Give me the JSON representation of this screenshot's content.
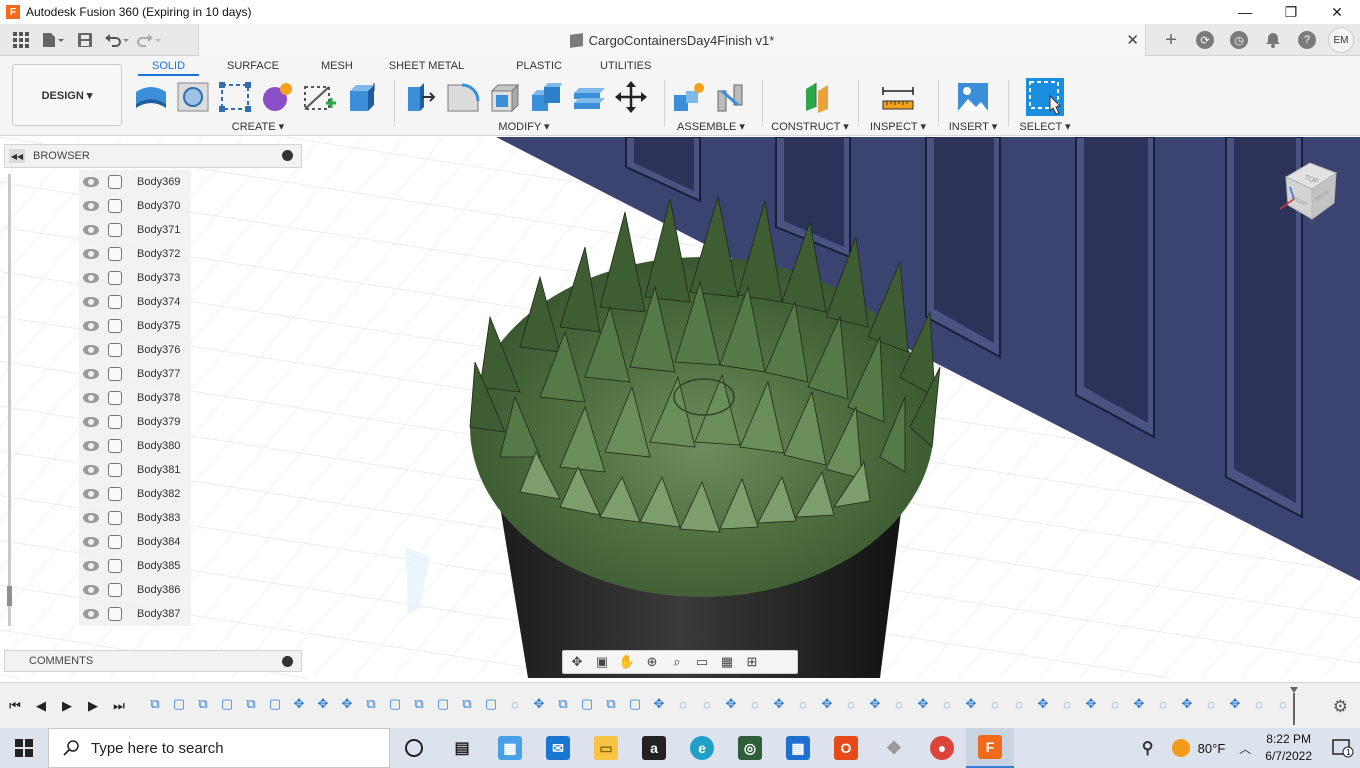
{
  "window": {
    "title": "Autodesk Fusion 360 (Expiring in 10 days)",
    "minimize": "—",
    "maximize": "❐",
    "close": "✕"
  },
  "document": {
    "name": "CargoContainersDay4Finish v1*",
    "close": "✕"
  },
  "tabrow": {
    "plus": "+",
    "avatar": "EM"
  },
  "toolbar": {
    "design_label": "DESIGN ▾",
    "workspace_tabs": [
      "SOLID",
      "SURFACE",
      "MESH",
      "SHEET METAL",
      "PLASTIC",
      "UTILITIES"
    ],
    "groups": {
      "create": "CREATE ▾",
      "modify": "MODIFY ▾",
      "assemble": "ASSEMBLE ▾",
      "construct": "CONSTRUCT ▾",
      "inspect": "INSPECT ▾",
      "insert": "INSERT ▾",
      "select": "SELECT ▾"
    }
  },
  "browser": {
    "title": "BROWSER",
    "bodies": [
      "Body369",
      "Body370",
      "Body371",
      "Body372",
      "Body373",
      "Body374",
      "Body375",
      "Body376",
      "Body377",
      "Body378",
      "Body379",
      "Body380",
      "Body381",
      "Body382",
      "Body383",
      "Body384",
      "Body385",
      "Body386",
      "Body387"
    ]
  },
  "comments": {
    "title": "COMMENTS"
  },
  "viewcube": {
    "top": "TOP",
    "front": "FRONT",
    "right": "RIGHT"
  },
  "taskbar": {
    "search_placeholder": "Type here to search",
    "temperature": "80°F",
    "time": "8:22 PM",
    "date": "6/7/2022",
    "notification_count": "1"
  },
  "colors": {
    "accent": "#1a74d6",
    "plant": "#4c6b3e",
    "container": "#3b4470",
    "pot": "#2a2a2a"
  }
}
